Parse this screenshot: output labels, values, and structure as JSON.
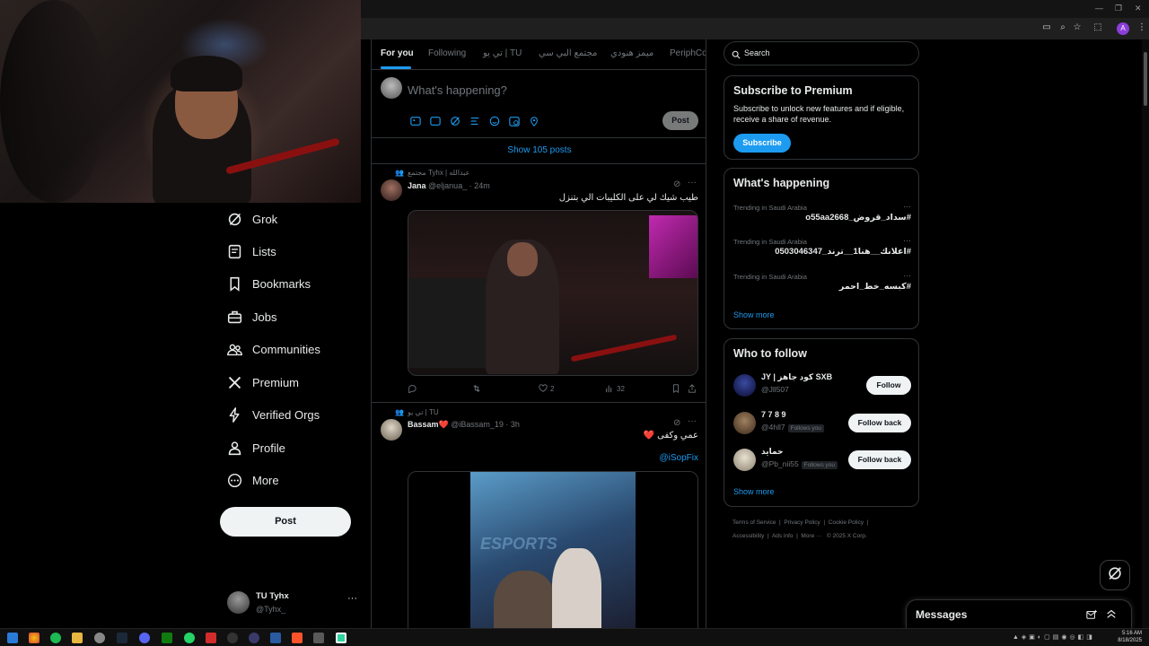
{
  "feed": {
    "tabs": [
      "For you",
      "Following",
      "تي يو | TU",
      "مجتمع البي سي",
      "ميمز هنودي",
      "PeriphCor"
    ],
    "compose_placeholder": "What's happening?",
    "compose_post_label": "Post",
    "show_posts": "Show 105 posts",
    "tweets": [
      {
        "context": "مجتمع Tyhx | عبدالله",
        "name": "Jana",
        "handle": "@eljanua_ · 24m",
        "text": "طيب شيك لي على الكليبات الي بتنزل",
        "replies": "",
        "reposts": "",
        "likes": "2",
        "views": "32"
      },
      {
        "context": "تي يو | TU",
        "name": "Bassam",
        "heart": "❤️",
        "handle": "@iBassam_19 · 3h",
        "text": "عمي وكفى ❤️",
        "mention": "@iSopFix"
      }
    ]
  },
  "nav": {
    "items": [
      {
        "label": "Grok",
        "icon": "grok-icon"
      },
      {
        "label": "Lists",
        "icon": "lists-icon"
      },
      {
        "label": "Bookmarks",
        "icon": "bookmark-icon"
      },
      {
        "label": "Jobs",
        "icon": "briefcase-icon"
      },
      {
        "label": "Communities",
        "icon": "communities-icon"
      },
      {
        "label": "Premium",
        "icon": "x-logo-icon"
      },
      {
        "label": "Verified Orgs",
        "icon": "lightning-icon"
      },
      {
        "label": "Profile",
        "icon": "person-icon"
      },
      {
        "label": "More",
        "icon": "more-circle-icon"
      }
    ],
    "post_label": "Post",
    "account": {
      "name": "TU Tyhx",
      "handle": "@Tyhx_"
    }
  },
  "sidebar": {
    "search_placeholder": "Search",
    "premium": {
      "title": "Subscribe to Premium",
      "body": "Subscribe to unlock new features and if eligible, receive a share of revenue.",
      "button": "Subscribe"
    },
    "happening": {
      "title": "What's happening",
      "trends": [
        {
          "location": "Trending in Saudi Arabia",
          "tag": "#سداد_قروض_o55aa2668"
        },
        {
          "location": "Trending in Saudi Arabia",
          "tag": "#اعلانك__هنا1__ترند_0503046347"
        },
        {
          "location": "Trending in Saudi Arabia",
          "tag": "#كبسه_خط_احمر"
        }
      ],
      "show_more": "Show more"
    },
    "who_to_follow": {
      "title": "Who to follow",
      "people": [
        {
          "name": "JY | كود جاهز SXB",
          "handle": "@Jll507",
          "follows_you": "",
          "button": "Follow"
        },
        {
          "name": "7 7 8 9",
          "handle": "@4hll7",
          "follows_you": "Follows you",
          "button": "Follow back"
        },
        {
          "name": "حمايد",
          "handle": "@Pb_nii55",
          "follows_you": "Follows you",
          "button": "Follow back"
        }
      ],
      "show_more": "Show more"
    },
    "footer": {
      "line1": [
        "Terms of Service",
        "Privacy Policy",
        "Cookie Policy"
      ],
      "line2": [
        "Accessibility",
        "Ads info",
        "More ···",
        "© 2025 X Corp."
      ]
    }
  },
  "messages": {
    "title": "Messages"
  },
  "taskbar": {
    "time": "5:16 AM",
    "date": "8/18/2025"
  },
  "colors": {
    "accent": "#1d9bf0",
    "background": "#000000",
    "border": "#2f3336",
    "muted": "#71767b"
  }
}
